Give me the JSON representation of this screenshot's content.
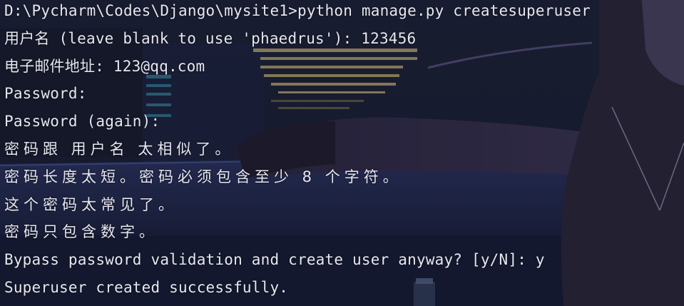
{
  "terminal": {
    "lines": [
      "D:\\Pycharm\\Codes\\Django\\mysite1>python manage.py createsuperuser",
      "用户名 (leave blank to use 'phaedrus'): 123456",
      "电子邮件地址: 123@qq.com",
      "Password:",
      "Password (again):",
      "密码跟 用户名 太相似了。",
      "密码长度太短。密码必须包含至少 8 个字符。",
      "这个密码太常见了。",
      "密码只包含数字。",
      "Bypass password validation and create user anyway? [y/N]: y",
      "Superuser created successfully."
    ]
  },
  "colors": {
    "background": "#141729",
    "text": "#e7e7ef",
    "accent_window": "#d8c27a",
    "accent_cyan": "#3fb4c9"
  }
}
